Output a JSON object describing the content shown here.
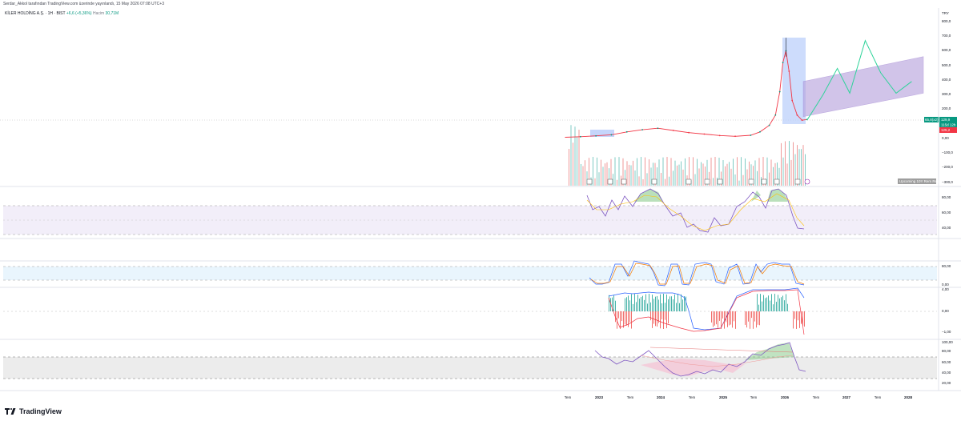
{
  "header": {
    "attribution": "Serdar_Akkol tarafından TradingView.com üzerinde yayınlandı, 15 May 2026 07:08 UTC+3"
  },
  "legend": {
    "symbol": "KİLER HOLDİNG A.Ş. · 1H · BIST",
    "change": "+6,6 (+5,36%)",
    "volume_label": "Hacim",
    "volume_value": "30,71M"
  },
  "price_axis": {
    "currency": "TRY",
    "ticks": [
      "800,0",
      "700,0",
      "600,0",
      "500,0",
      "400,0",
      "300,0",
      "200,0",
      "100,0",
      "0,00",
      "−100,0",
      "−200,0",
      "−300,0"
    ]
  },
  "price_badges": {
    "last": "129,9",
    "countdown": "115d 12h",
    "low": "125,2",
    "left": "65,8(x2)",
    "volume_tag": "Upcoming 10Y Rem Rest"
  },
  "indicator_axes": {
    "rsi": [
      "80,00",
      "60,00",
      "40,00"
    ],
    "stoch": [
      "80,00",
      "0,00"
    ],
    "osc": [
      "4,00",
      "0,00",
      "−1,00"
    ],
    "rsi2": [
      "100,00",
      "80,00",
      "60,00",
      "40,00",
      "20,00"
    ]
  },
  "time_axis": [
    "Tem",
    "2023",
    "Tem",
    "2024",
    "Tem",
    "2025",
    "Tem",
    "2026",
    "Tem",
    "2027",
    "Tem",
    "2028"
  ],
  "brand": {
    "name": "TradingView"
  },
  "colors": {
    "up": "#089981",
    "down": "#f23645",
    "projection": "#2fd39a",
    "channel": "#b39ddb",
    "rsi_band": "#ede7f6",
    "stoch_band": "#e3f2fd",
    "rsi2_band": "#e0e0e0"
  },
  "chart_data": {
    "type": "line",
    "title": "KİLER HOLDİNG A.Ş. · 1H · BIST",
    "ylabel": "TRY",
    "ylim": [
      -300,
      800
    ],
    "x_labels": [
      "Tem",
      "2023",
      "Tem",
      "2024",
      "Tem",
      "2025",
      "Tem",
      "2026",
      "Tem",
      "2027",
      "Tem",
      "2028"
    ],
    "series": [
      {
        "name": "KİLER HOLDİNG A.Ş.",
        "x": [
          2022.45,
          2022.7,
          2022.95,
          2023.2,
          2023.45,
          2023.7,
          2023.95,
          2024.2,
          2024.45,
          2024.7,
          2024.95,
          2025.2,
          2025.45,
          2025.6,
          2025.75,
          2025.85,
          2025.92,
          2025.97,
          2026.02,
          2026.07,
          2026.12,
          2026.2,
          2026.28,
          2026.36
        ],
        "values": [
          8,
          12,
          18,
          25,
          45,
          60,
          70,
          55,
          40,
          30,
          20,
          15,
          22,
          45,
          90,
          160,
          320,
          520,
          600,
          460,
          260,
          160,
          125,
          129.9
        ]
      },
      {
        "name": "Projection",
        "x": [
          2026.36,
          2026.62,
          2026.85,
          2027.05,
          2027.3,
          2027.55,
          2027.8,
          2028.05
        ],
        "values": [
          125,
          300,
          480,
          310,
          670,
          450,
          310,
          390
        ]
      }
    ],
    "channel": {
      "upper": [
        [
          2026.3,
          390
        ],
        [
          2028.5,
          560
        ]
      ],
      "lower": [
        [
          2026.3,
          150
        ],
        [
          2028.5,
          310
        ]
      ]
    },
    "grid": true,
    "legend_position": "top-left"
  }
}
